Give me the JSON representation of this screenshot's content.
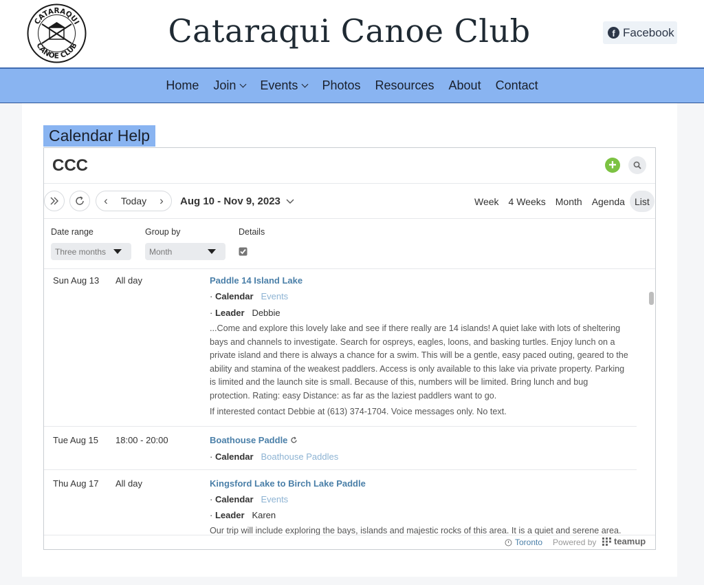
{
  "site": {
    "title": "Cataraqui Canoe Club",
    "logo_text_top": "CATARAQUI",
    "logo_text_bottom": "CANOE CLUB",
    "facebook_label": "Facebook"
  },
  "nav": {
    "home": "Home",
    "join": "Join",
    "events": "Events",
    "photos": "Photos",
    "resources": "Resources",
    "about": "About",
    "contact": "Contact"
  },
  "page": {
    "title": "Calendar Help"
  },
  "calendar": {
    "title": "CCC",
    "today_label": "Today",
    "date_range": "Aug 10 - Nov 9, 2023",
    "views": [
      "Week",
      "4 Weeks",
      "Month",
      "Agenda",
      "List"
    ],
    "active_view": "List",
    "filters": {
      "date_range_label": "Date range",
      "date_range_value": "Three months",
      "group_by_label": "Group by",
      "group_by_value": "Month",
      "details_label": "Details",
      "details_checked": true
    },
    "events": [
      {
        "date": "Sun Aug 13",
        "time": "All day",
        "title": "Paddle 14 Island Lake",
        "calendar_label": "Calendar",
        "calendar_value": "Events",
        "leader_label": "Leader",
        "leader_value": "Debbie",
        "description": "...Come and explore this lovely lake and see if there really are 14 islands!  A quiet lake with lots of sheltering bays and channels to investigate.  Search for ospreys, eagles, loons, and basking turtles.  Enjoy lunch on a private island and there is always a chance for a swim. This will be a gentle, easy paced outing, geared to the ability and stamina of the weakest paddlers.  Access is only available to this lake via private property. Parking is limited and the launch site is small. Because of this, numbers will be limited. Bring lunch and bug protection. Rating: easy Distance: as far as the laziest paddlers want to go.",
        "contact": "If interested contact Debbie at (613) 374-1704.  Voice messages only. No text."
      },
      {
        "date": "Tue Aug 15",
        "time": "18:00 - 20:00",
        "title": "Boathouse Paddle",
        "calendar_label": "Calendar",
        "calendar_value": "Boathouse Paddles"
      },
      {
        "date": "Thu Aug 17",
        "time": "All day",
        "title": "Kingsford Lake to Birch Lake Paddle",
        "calendar_label": "Calendar",
        "calendar_value": "Events",
        "leader_label": "Leader",
        "leader_value": "Karen",
        "description": "Our trip will include exploring the bays, islands and majestic rocks of this area. It is a quiet and serene area."
      }
    ],
    "footer": {
      "timezone": "Toronto",
      "powered_by": "Powered by",
      "brand": "teamup"
    }
  },
  "colors": {
    "nav_bg": "#89b4f1",
    "link": "#4a7fa8",
    "add_button": "#7cc242"
  }
}
